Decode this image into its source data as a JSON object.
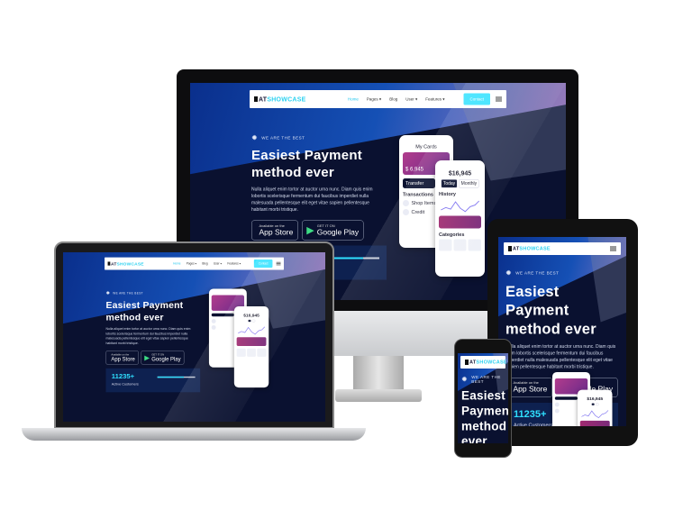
{
  "site": {
    "logo_a": "AT",
    "logo_b": "SHOWCASE",
    "nav": [
      "Home",
      "Pages ▾",
      "Blog",
      "User ▾",
      "Features ▾"
    ],
    "contact": "Contact",
    "badge": "WE ARE THE BEST",
    "headline": "Easiest Payment method ever",
    "paragraph": "Nulla aliquet enim tortor at auctor urna nunc. Diam quis enim lobortis scelerisque fermentum dui faucibus imperdiet nulla malesuada pellentesque elit eget vitae sapien pellentesque habitant morbi tristique.",
    "appstore": {
      "top": "Available on the",
      "name": "App Store"
    },
    "googleplay": {
      "top": "GET IT ON",
      "name": "Google Play"
    },
    "stats": {
      "value": "11235+",
      "label": "Active Customers",
      "progress": 0.7
    },
    "phone1": {
      "title": "My Cards",
      "balance": "$ 6,945",
      "transfer": "Transfer",
      "transactions": "Transactions",
      "tx": [
        "Shop Items",
        "Credit"
      ]
    },
    "phone2": {
      "balance": "$16,945",
      "tabs": [
        "Today",
        "Monthly"
      ],
      "history": "History",
      "categories": "Categories"
    }
  },
  "colors": {
    "accent": "#2fe0ff",
    "navy": "#0a1130",
    "pink": "#d77ed0"
  }
}
